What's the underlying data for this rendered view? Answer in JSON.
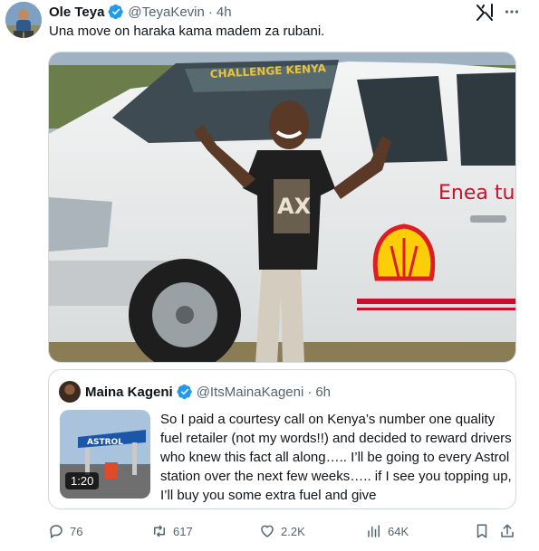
{
  "tweet": {
    "author": {
      "display_name": "Ole Teya",
      "handle": "@TeyaKevin",
      "time": "4h",
      "separator": "·"
    },
    "text": "Una move on haraka kama madem za rubani.",
    "photo": {
      "truck_windshield_text": "CHALLENGE KENYA",
      "truck_door_text": "Enea tu",
      "shirt_text": "AX"
    }
  },
  "quote": {
    "author": {
      "display_name": "Maina Kageni",
      "handle": "@ItsMainaKageni",
      "time": "6h",
      "separator": "·"
    },
    "video_duration": "1:20",
    "thumbnail_sign_text": "ASTROL",
    "text": "So I paid a courtesy call on Kenya’s number one quality fuel retailer (not my words!!) and decided to reward drivers who knew this fact all along….. I’ll be going to every Astrol station over the next few weeks….. if I see you topping up, I’ll buy you some extra fuel and give"
  },
  "actions": {
    "replies": "76",
    "reposts": "617",
    "likes": "2.2K",
    "views": "64K"
  },
  "colors": {
    "verified_blue": "#1d9bf0",
    "muted_text": "#536471",
    "border": "#cfd9de",
    "shell_red": "#dd1d21",
    "shell_yellow": "#fbce07"
  },
  "icons": {
    "grok": "grok-icon",
    "more": "more-icon",
    "reply": "reply-icon",
    "repost": "repost-icon",
    "like": "like-icon",
    "views": "views-icon",
    "bookmark": "bookmark-icon",
    "share": "share-icon",
    "verified": "verified-badge-icon"
  }
}
